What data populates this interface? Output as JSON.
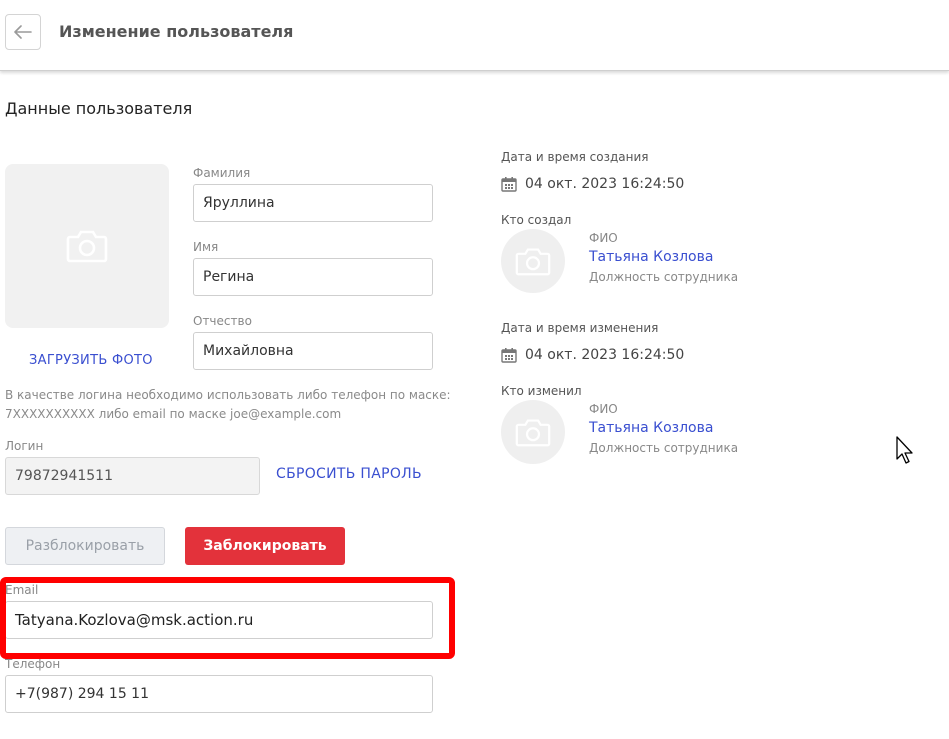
{
  "header": {
    "back_icon": "arrow-left-icon",
    "title": "Изменение пользователя"
  },
  "section": {
    "title": "Данные пользователя"
  },
  "photo": {
    "icon": "camera-icon",
    "upload_label": "ЗАГРУЗИТЬ ФОТО"
  },
  "fields": {
    "surname": {
      "label": "Фамилия",
      "value": "Яруллина"
    },
    "name": {
      "label": "Имя",
      "value": "Регина"
    },
    "patronymic": {
      "label": "Отчество",
      "value": "Михайловна"
    }
  },
  "login": {
    "hint_line1": "В качестве логина необходимо использовать либо телефон по маске:",
    "hint_line2": "7XXXXXXXXXX либо email по маске joe@example.com",
    "label": "Логин",
    "value": "79872941511",
    "reset_label": "СБРОСИТЬ ПАРОЛЬ"
  },
  "actions": {
    "unlock_label": "Разблокировать",
    "block_label": "Заблокировать"
  },
  "email": {
    "label": "Email",
    "value": "Tatyana.Kozlova@msk.action.ru"
  },
  "phone": {
    "label": "Телефон",
    "value": "+7(987) 294 15 11"
  },
  "created": {
    "datetime_label": "Дата и время создания",
    "datetime_value": "04 окт. 2023 16:24:50",
    "by_label": "Кто создал",
    "fio_label": "ФИО",
    "person_name": "Татьяна Козлова",
    "person_role": "Должность сотрудника"
  },
  "modified": {
    "datetime_label": "Дата и время изменения",
    "datetime_value": "04 окт. 2023 16:24:50",
    "by_label": "Кто изменил",
    "fio_label": "ФИО",
    "person_name": "Татьяна Козлова",
    "person_role": "Должность сотрудника"
  },
  "colors": {
    "accent_link": "#3a4fd0",
    "danger": "#e3323b",
    "highlight": "#ff0000"
  }
}
